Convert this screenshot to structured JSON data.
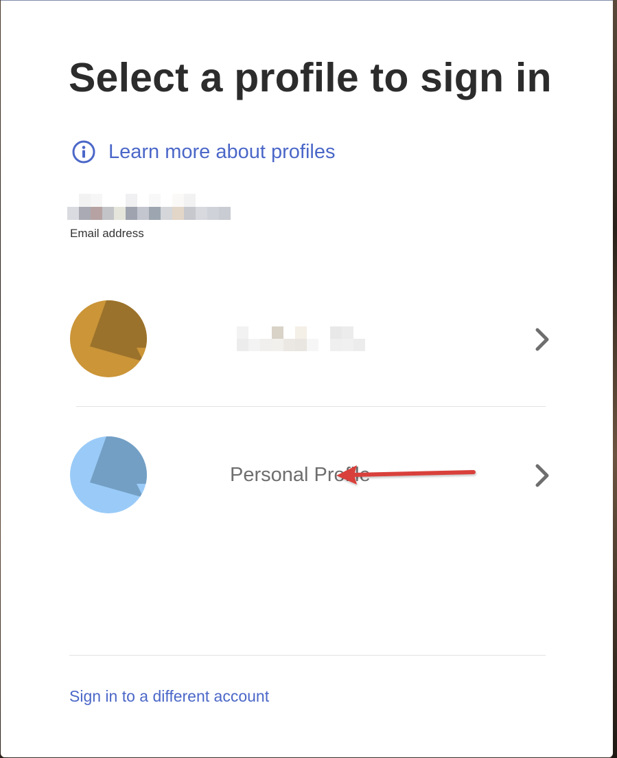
{
  "dialog": {
    "title": "Select a profile to sign in",
    "learn_more": {
      "label": "Learn more about profiles",
      "icon": "info-icon"
    },
    "account": {
      "email_value": "",
      "email_redacted": true,
      "email_label": "Email address"
    },
    "profiles": [
      {
        "name": "",
        "name_redacted": true,
        "avatar_color": "#cb9538",
        "avatar_shade": "#9b722b",
        "chevron_icon": "chevron-right-icon"
      },
      {
        "name": "Personal Profile",
        "name_redacted": false,
        "avatar_color": "#9acbf8",
        "avatar_shade": "#739fc4",
        "chevron_icon": "chevron-right-icon"
      }
    ],
    "footer": {
      "different_account": "Sign in to a different account"
    }
  },
  "colors": {
    "link": "#4b67c8",
    "title": "#2c2c2c",
    "annotation_arrow": "#d9413b"
  }
}
